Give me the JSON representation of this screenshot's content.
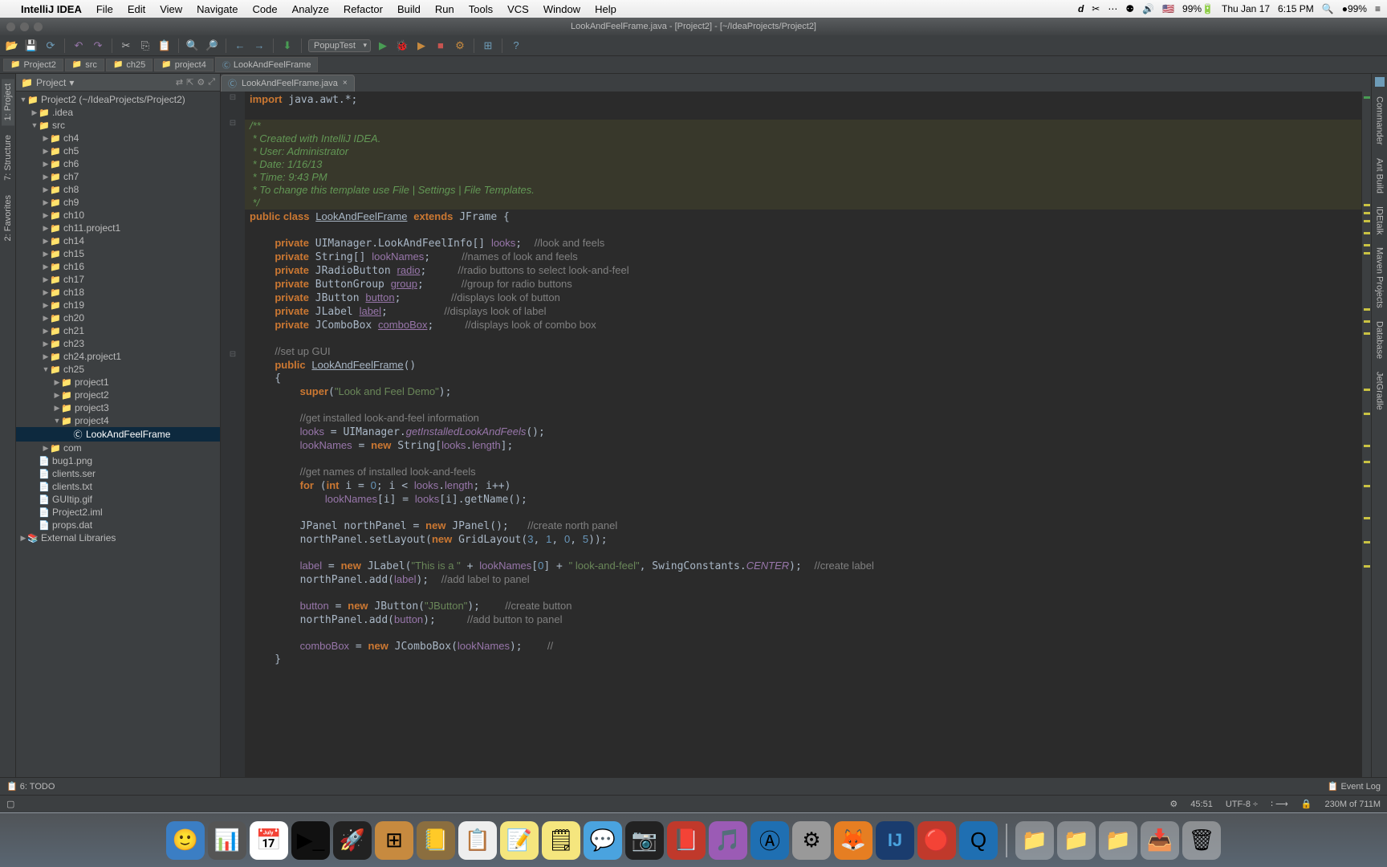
{
  "mac": {
    "app": "IntelliJ IDEA",
    "menus": [
      "File",
      "Edit",
      "View",
      "Navigate",
      "Code",
      "Analyze",
      "Refactor",
      "Build",
      "Run",
      "Tools",
      "VCS",
      "Window",
      "Help"
    ],
    "right": {
      "flag": "🇺🇸",
      "battery1": "99%",
      "day": "Thu Jan 17",
      "time": "6:15 PM",
      "battery2": "99%"
    }
  },
  "title": "LookAndFeelFrame.java - [Project2] - [~/IdeaProjects/Project2]",
  "toolbar": {
    "combo": "PopupTest"
  },
  "crumbs": [
    "Project2",
    "src",
    "ch25",
    "project4",
    "LookAndFeelFrame"
  ],
  "projectPanel": {
    "title": "Project",
    "root": "Project2 (~/IdeaProjects/Project2)",
    "idea": ".idea",
    "src": "src",
    "srcChildren": [
      "ch4",
      "ch5",
      "ch6",
      "ch7",
      "ch8",
      "ch9",
      "ch10",
      "ch11.project1",
      "ch14",
      "ch15",
      "ch16",
      "ch17",
      "ch18",
      "ch19",
      "ch20",
      "ch21",
      "ch23",
      "ch24.project1"
    ],
    "ch25": "ch25",
    "ch25Children": [
      "project1",
      "project2",
      "project3"
    ],
    "project4": "project4",
    "selectedFile": "LookAndFeelFrame",
    "com": "com",
    "files": [
      "bug1.png",
      "clients.ser",
      "clients.txt",
      "GUItip.gif",
      "Project2.iml",
      "props.dat"
    ],
    "external": "External Libraries"
  },
  "editorTab": "LookAndFeelFrame.java",
  "leftTabs": [
    "1: Project",
    "7: Structure",
    "2: Favorites"
  ],
  "rightTabs": [
    "Commander",
    "Ant Build",
    "IDEtalk",
    "Maven Projects",
    "Database",
    "JetGradle"
  ],
  "bottomLeft": "6: TODO",
  "bottomRight": "Event Log",
  "status": {
    "line": "45:51",
    "enc": "UTF-8",
    "mem": "230M of 711M"
  }
}
